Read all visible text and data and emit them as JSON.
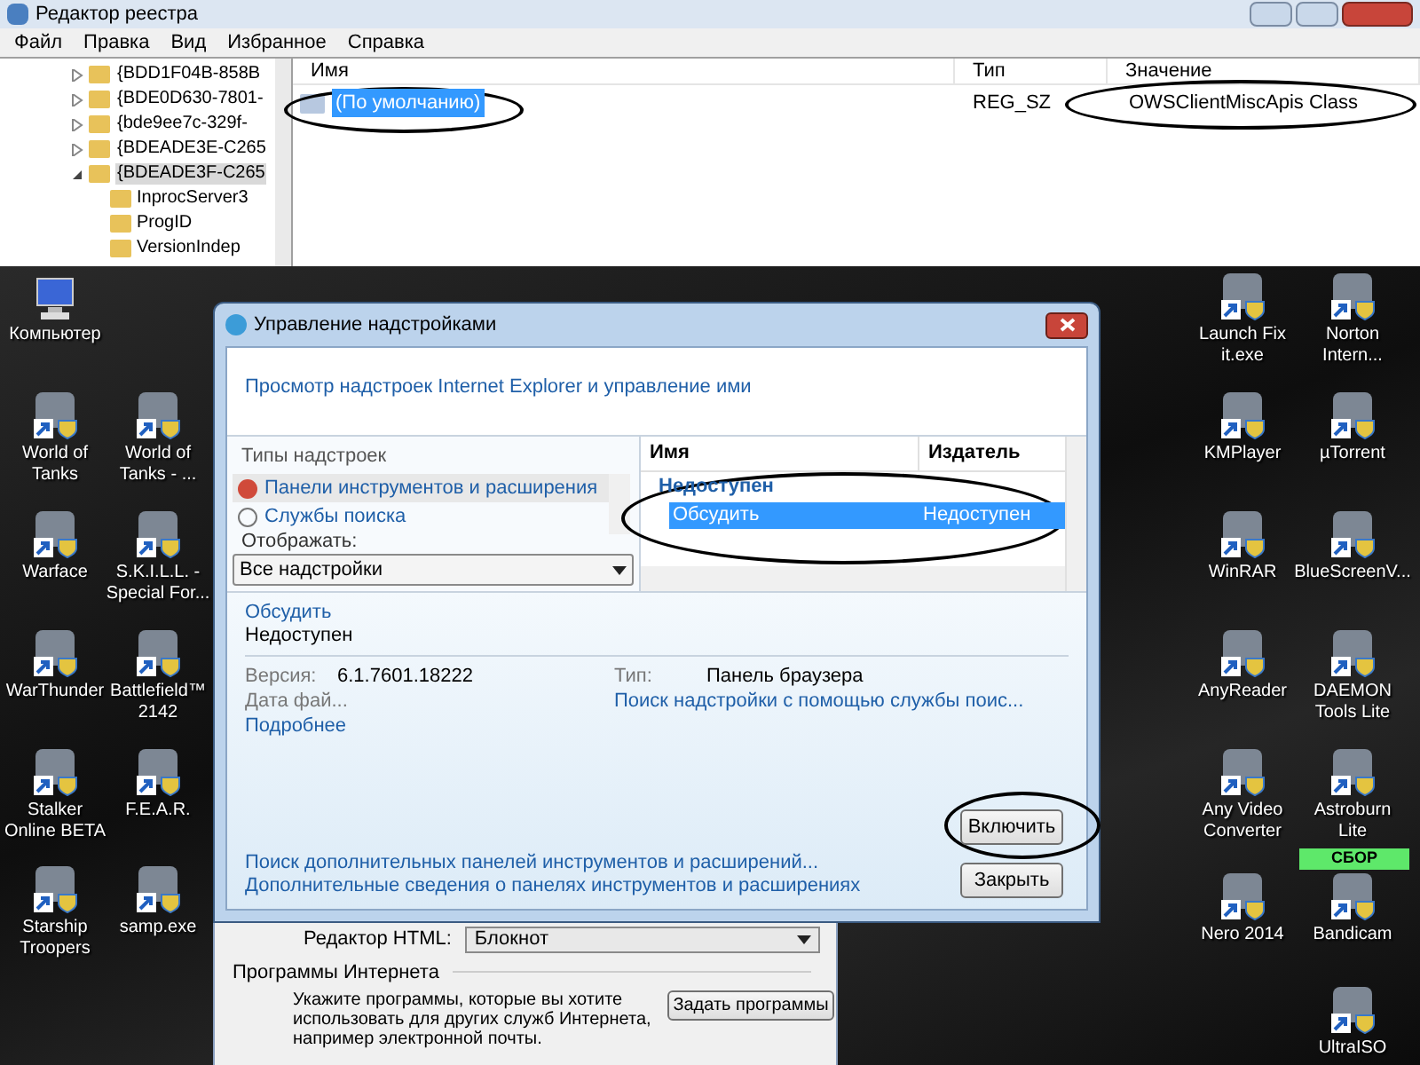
{
  "registry_editor": {
    "title": "Редактор реестра",
    "menu": [
      "Файл",
      "Правка",
      "Вид",
      "Избранное",
      "Справка"
    ],
    "tree": [
      {
        "label": "{BDD1F04B-858B",
        "expanded": false,
        "selected": false
      },
      {
        "label": "{BDE0D630-7801-",
        "expanded": false,
        "selected": false
      },
      {
        "label": "{bde9ee7c-329f-",
        "expanded": false,
        "selected": false
      },
      {
        "label": "{BDEADE3E-C265",
        "expanded": false,
        "selected": false
      },
      {
        "label": "{BDEADE3F-C265",
        "expanded": true,
        "selected": true,
        "children": [
          {
            "label": "InprocServer3",
            "selected": false
          },
          {
            "label": "ProgID",
            "selected": false
          },
          {
            "label": "VersionIndep",
            "selected": false
          }
        ]
      }
    ],
    "columns": [
      "Имя",
      "Тип",
      "Значение"
    ],
    "rows": [
      {
        "name": "(По умолчанию)",
        "type": "REG_SZ",
        "value": "OWSClientMiscApis Class",
        "selected": true
      }
    ]
  },
  "desktop": {
    "left_icons": [
      {
        "label": "Компьютер",
        "kind": "computer"
      },
      {
        "label": "World of Tanks",
        "kind": "shortcut"
      },
      {
        "label": "World of Tanks - ...",
        "kind": "shortcut"
      },
      {
        "label": "Warface",
        "kind": "shortcut"
      },
      {
        "label": "S.K.I.L.L. - Special For...",
        "kind": "shortcut"
      },
      {
        "label": "WarThunder",
        "kind": "shortcut"
      },
      {
        "label": "Battlefield™ 2142",
        "kind": "shortcut"
      },
      {
        "label": "Stalker Online BETA",
        "kind": "shortcut"
      },
      {
        "label": "F.E.A.R.",
        "kind": "shortcut"
      },
      {
        "label": "Starship Troopers",
        "kind": "shortcut"
      },
      {
        "label": "samp.exe",
        "kind": "shortcut"
      }
    ],
    "right_icons": [
      {
        "label": "Launch Fix it.exe",
        "kind": "shortcut"
      },
      {
        "label": "Norton Intern...",
        "kind": "shortcut"
      },
      {
        "label": "KMPlayer",
        "kind": "shortcut"
      },
      {
        "label": "µTorrent",
        "kind": "shortcut"
      },
      {
        "label": "WinRAR",
        "kind": "shortcut"
      },
      {
        "label": "BlueScreenV...",
        "kind": "shortcut"
      },
      {
        "label": "AnyReader",
        "kind": "shortcut"
      },
      {
        "label": "DAEMON Tools Lite",
        "kind": "shortcut"
      },
      {
        "label": "Any Video Converter",
        "kind": "shortcut"
      },
      {
        "label": "Astroburn Lite",
        "kind": "shortcut"
      },
      {
        "label": "Nero 2014",
        "kind": "shortcut"
      },
      {
        "label": "Bandicam",
        "kind": "shortcut"
      },
      {
        "label": "UltraISO",
        "kind": "shortcut"
      }
    ],
    "badge": "СБОР"
  },
  "addons_dialog": {
    "title": "Управление надстройками",
    "header": "Просмотр надстроек Internet Explorer и управление ими",
    "types_label": "Типы надстроек",
    "types": [
      {
        "label": "Панели инструментов и расширения",
        "selected": true
      },
      {
        "label": "Службы поиска",
        "selected": false
      }
    ],
    "show_label": "Отображать:",
    "show_value": "Все надстройки",
    "columns": [
      "Имя",
      "Издатель"
    ],
    "group": "Недоступен",
    "rows": [
      {
        "name": "Обсудить",
        "publisher": "Недоступен",
        "selected": true
      }
    ],
    "detail_name": "Обсудить",
    "detail_status": "Недоступен",
    "version_label": "Версия:",
    "version": "6.1.7601.18222",
    "type_label": "Тип:",
    "type": "Панель браузера",
    "date_label": "Дата фай...",
    "search_link": "Поиск надстройки с помощью службы поис...",
    "more_link": "Подробнее",
    "footer_links": [
      "Поиск дополнительных панелей инструментов и расширений...",
      "Дополнительные сведения о панелях инструментов и расширениях"
    ],
    "buttons": [
      "Включить",
      "Закрыть"
    ]
  },
  "internet_options": {
    "html_editor_label": "Редактор HTML:",
    "html_editor_value": "Блокнот",
    "group_title": "Программы Интернета",
    "description": "Укажите программы, которые вы хотите использовать для других служб Интернета, например электронной почты.",
    "button": "Задать программы"
  }
}
